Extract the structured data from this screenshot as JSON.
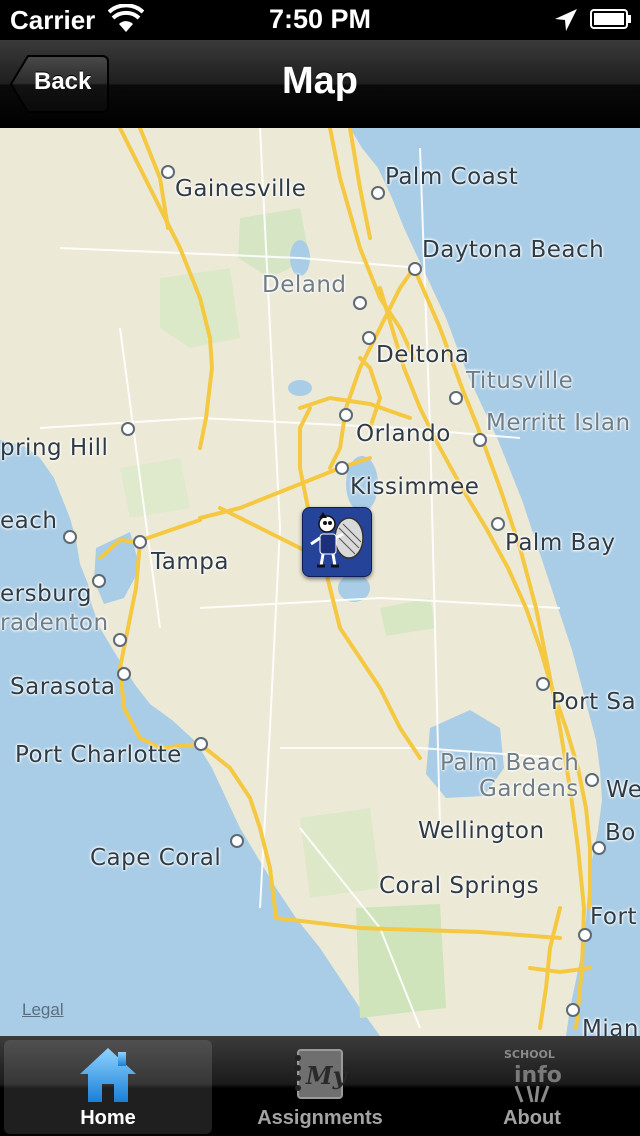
{
  "status_bar": {
    "carrier": "Carrier",
    "time": "7:50 PM",
    "icons": [
      "wifi-icon",
      "location-arrow-icon",
      "battery-icon"
    ]
  },
  "nav_bar": {
    "back_label": "Back",
    "title": "Map"
  },
  "map": {
    "legal_link": "Legal",
    "cities": [
      {
        "name": "Gainesville"
      },
      {
        "name": "Palm Coast"
      },
      {
        "name": "Daytona Beach"
      },
      {
        "name": "Deland"
      },
      {
        "name": "Deltona"
      },
      {
        "name": "Titusville"
      },
      {
        "name": "Orlando"
      },
      {
        "name": "Merritt Islan"
      },
      {
        "name": "pring Hill"
      },
      {
        "name": "Kissimmee"
      },
      {
        "name": "each"
      },
      {
        "name": "Tampa"
      },
      {
        "name": "Palm Bay"
      },
      {
        "name": "ersburg"
      },
      {
        "name": "radenton"
      },
      {
        "name": "Sarasota"
      },
      {
        "name": "Port Sa"
      },
      {
        "name": "Port Charlotte"
      },
      {
        "name": "Palm Beach"
      },
      {
        "name": "Gardens"
      },
      {
        "name": "We"
      },
      {
        "name": "Wellington"
      },
      {
        "name": "Bo"
      },
      {
        "name": "Cape Coral"
      },
      {
        "name": "Coral Springs"
      },
      {
        "name": "Fort"
      },
      {
        "name": "Mian"
      }
    ],
    "pin_icon": "school-mascot-icon"
  },
  "tab_bar": {
    "tabs": [
      {
        "label": "Home",
        "icon": "home-icon",
        "active": true
      },
      {
        "label": "Assignments",
        "icon": "notebook-icon",
        "active": false
      },
      {
        "label": "About",
        "icon": "school-info-icon",
        "active": false
      }
    ]
  }
}
